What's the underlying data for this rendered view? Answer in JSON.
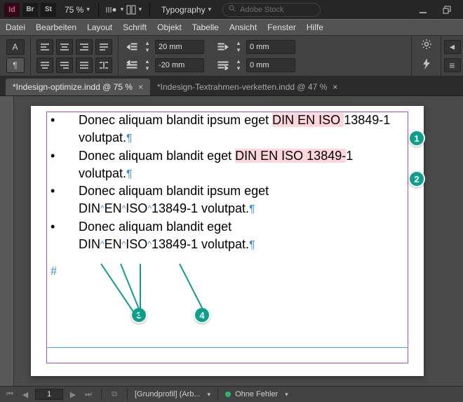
{
  "topbar": {
    "app_abbrev": "Id",
    "bridge_abbrev": "Br",
    "stock_abbrev": "St",
    "zoom": "75 %",
    "workspace": "Typography",
    "search_placeholder": "Adobe Stock"
  },
  "menu": {
    "items": [
      "Datei",
      "Bearbeiten",
      "Layout",
      "Schrift",
      "Objekt",
      "Tabelle",
      "Ansicht",
      "Fenster",
      "Hilfe"
    ]
  },
  "control": {
    "char_mode": "A",
    "para_mode": "¶",
    "left_indent": "20 mm",
    "right_indent": "0 mm",
    "first_line_indent": "-20 mm",
    "last_line_indent": "0 mm"
  },
  "tabs": {
    "items": [
      {
        "label": "*Indesign-optimize.indd @ 75 %",
        "active": true
      },
      {
        "label": "*Indesign-Textrahmen-verketten.indd @ 47 %",
        "active": false
      }
    ]
  },
  "document": {
    "bullets": [
      "Donec aliquam blandit ipsum eget ",
      "DIN EN ISO 13849-1",
      " volutpat."
    ],
    "item1_pre": "Donec aliquam blandit ipsum eget ",
    "item1_hl": "DIN EN ISO ",
    "item1_post": "13849-1 volutpat.",
    "item2_pre": "Donec aliquam blandit eget ",
    "item2_hl": "DIN EN ISO 13849-",
    "item2_post": "1 volutpat.",
    "item3_a": "Donec aliquam blandit ipsum eget",
    "item3_b": "DIN EN ISO 13849-1 volutpat.",
    "item4_a": "Donec aliquam blandit eget",
    "item4_b": "DIN EN ISO 13849-1 volutpat.",
    "pilcrow": "¶",
    "caret": "^",
    "end": "#"
  },
  "callouts": {
    "b1": "1",
    "b2": "2",
    "b3": "3",
    "b4": "4"
  },
  "status": {
    "page": "1",
    "profile": "[Grundprofil] (Arb...",
    "errors": "Ohne Fehler"
  }
}
